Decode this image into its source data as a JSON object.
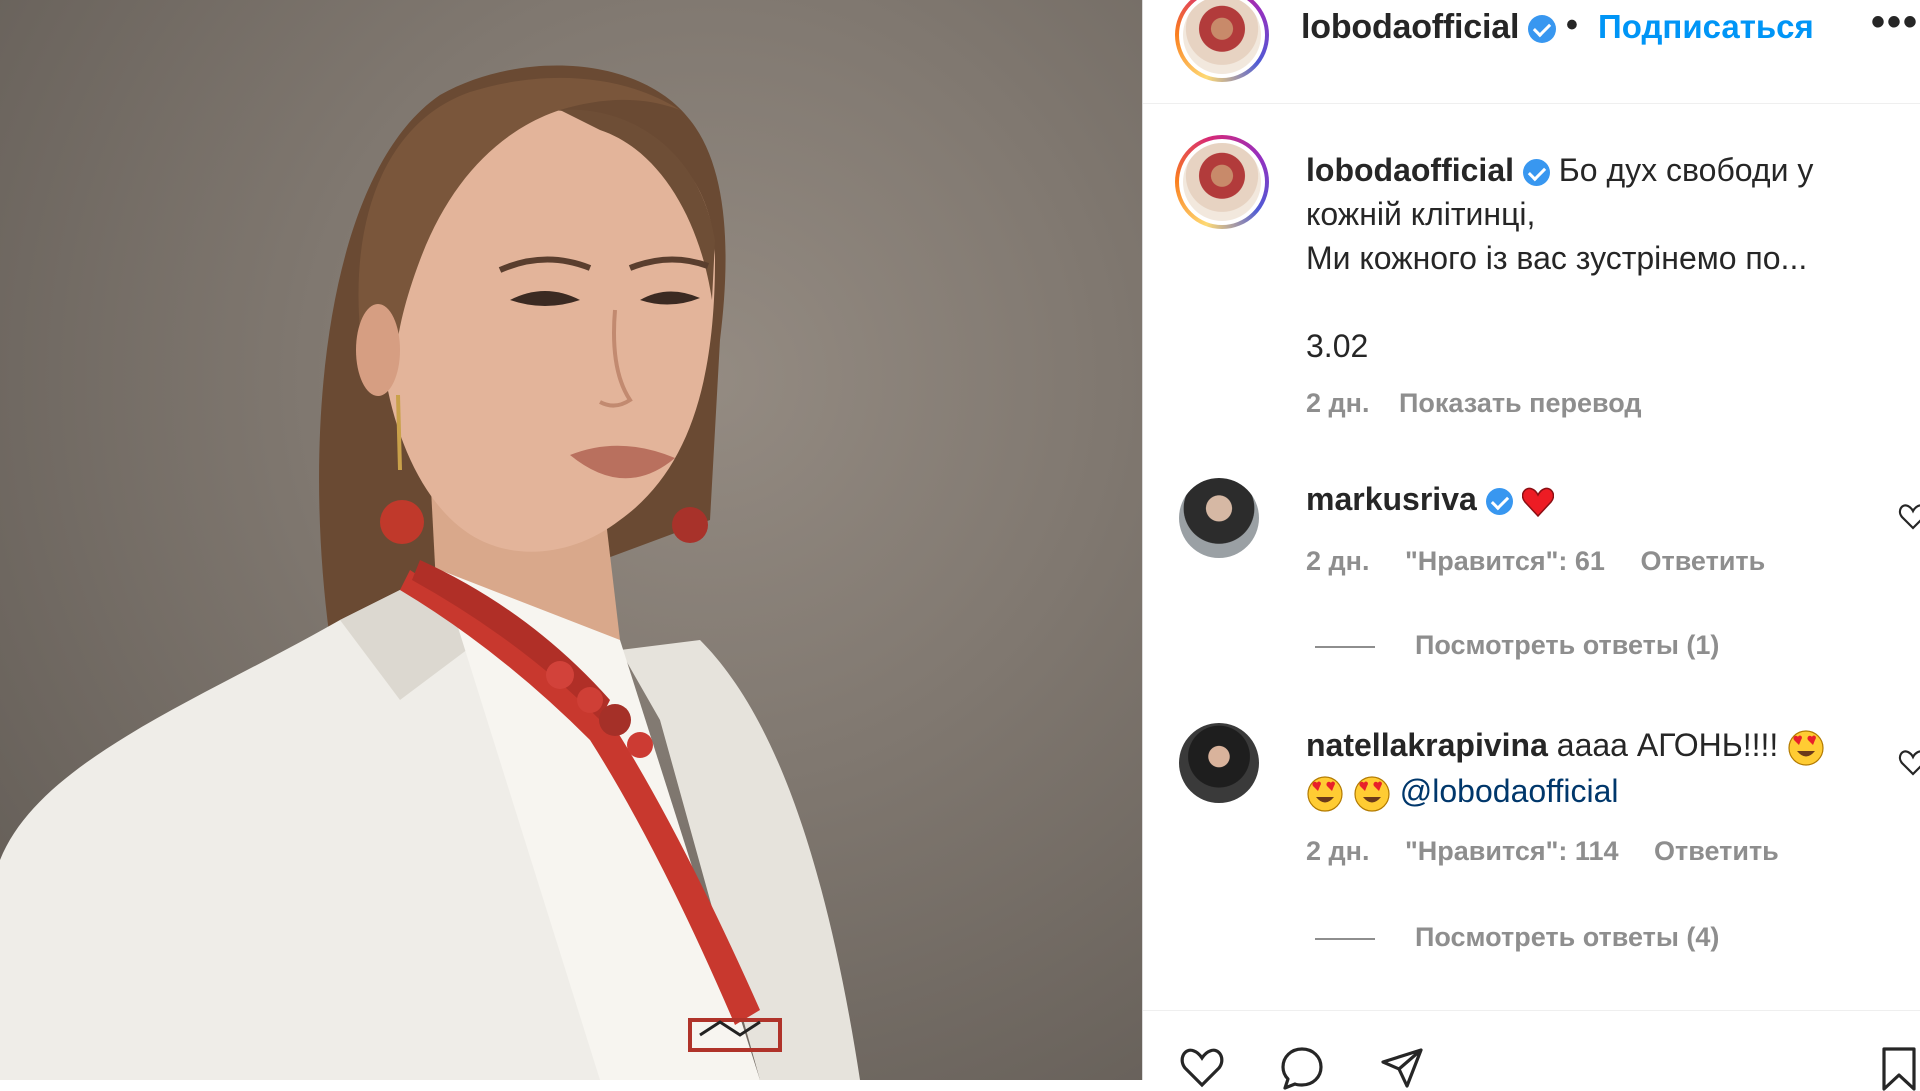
{
  "post": {
    "author": "lobodaofficial",
    "follow_label": "Подписаться",
    "separator": "•",
    "more_label": "•••"
  },
  "caption": {
    "username": "lobodaofficial",
    "line1": " Бо дух свободи у кожній клітинці,",
    "line2": "Ми кожного із вас зустрінемо по...",
    "line3": "3.02",
    "date": "2 дн.",
    "translate_label": "Показать перевод"
  },
  "comments": [
    {
      "username": "markusriva",
      "text": "",
      "date": "2 дн.",
      "likes": "\"Нравится\": 61",
      "reply_label": "Ответить",
      "view_replies": "Посмотреть ответы (1)"
    },
    {
      "username": "natellakrapivina",
      "text": " аааа АГОНЬ!!!!",
      "mention": "@lobodaofficial",
      "date": "2 дн.",
      "likes": "\"Нравится\": 114",
      "reply_label": "Ответить",
      "view_replies": "Посмотреть ответы (4)"
    }
  ],
  "colors": {
    "accent": "#0095f6",
    "verified": "#3897f0",
    "muted": "#8e8e8e",
    "heart": "#ed1c24"
  },
  "icons": [
    "verified-badge-icon",
    "heart-emoji-icon",
    "heart-eyes-emoji-icon",
    "like-icon",
    "comment-icon",
    "share-icon",
    "bookmark-icon",
    "more-icon"
  ]
}
